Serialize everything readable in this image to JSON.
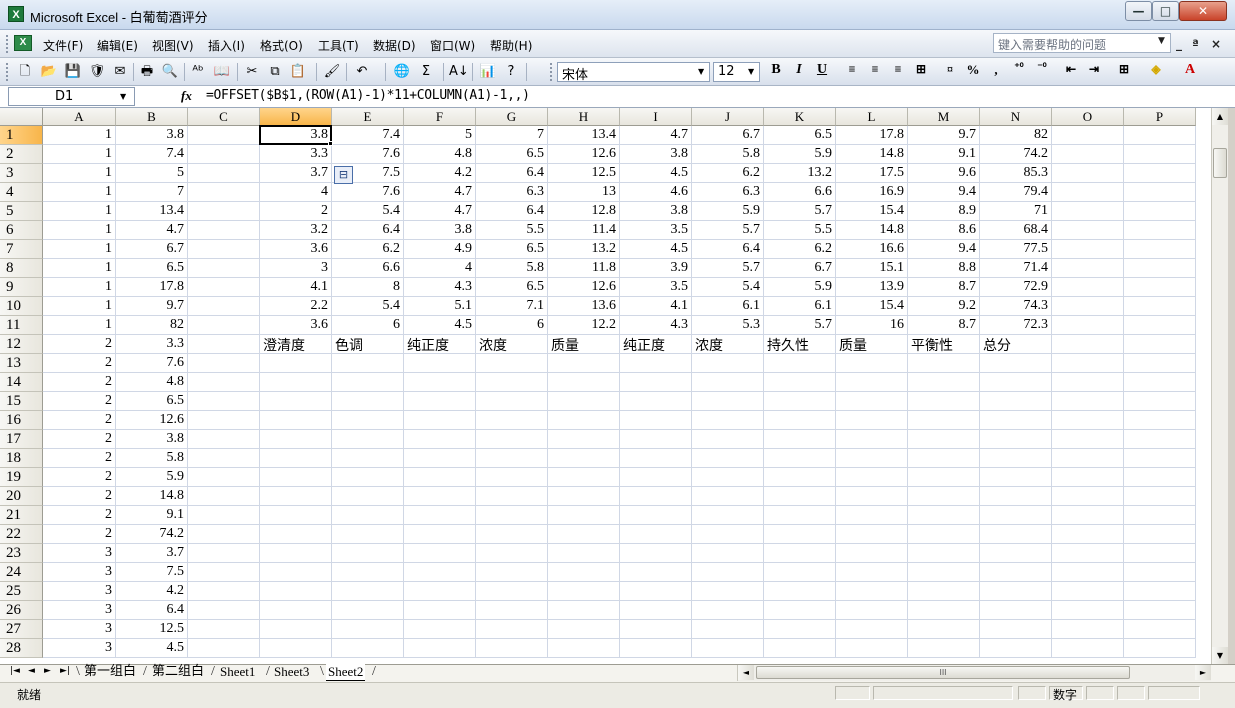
{
  "window": {
    "title": "Microsoft Excel - 白葡萄酒评分",
    "app_icon_text": "X",
    "minimize": "—",
    "maximize": "□",
    "close": "✕"
  },
  "menu": {
    "doc_icon_text": "X",
    "items": [
      "文件(F)",
      "编辑(E)",
      "视图(V)",
      "插入(I)",
      "格式(O)",
      "工具(T)",
      "数据(D)",
      "窗口(W)",
      "帮助(H)"
    ],
    "help_placeholder": "键入需要帮助的问题",
    "doc_minimize": "_",
    "doc_restore": "ª",
    "doc_close": "×"
  },
  "toolbar": {
    "icons": [
      "new-icon",
      "open-icon",
      "save-icon",
      "permission-icon",
      "email-icon",
      "print-icon",
      "print-preview-icon",
      "spelling-icon",
      "research-icon",
      "cut-icon",
      "copy-icon",
      "paste-icon",
      "format-painter-icon",
      "undo-icon",
      "hyperlink-icon",
      "autosum-icon",
      "sort-ascending-icon",
      "chart-wizard-icon",
      "help-icon"
    ],
    "icon_glyphs": [
      "🗋",
      "📂",
      "💾",
      "🛡",
      "✉",
      "🖶",
      "🔍",
      "ᴬᵇ",
      "📖",
      "✂",
      "⧉",
      "📋",
      "🖌",
      "↶",
      "🌐",
      "Σ",
      "A↓",
      "📊",
      "?"
    ],
    "font_name": "宋体",
    "font_size": "12",
    "bold": "B",
    "italic": "I",
    "underline": "U",
    "percent": "%",
    "comma": ","
  },
  "formula_bar": {
    "name_box": "D1",
    "fx": "fx",
    "formula": "=OFFSET($B$1,(ROW(A1)-1)*11+COLUMN(A1)-1,,)"
  },
  "columns": [
    "A",
    "B",
    "C",
    "D",
    "E",
    "F",
    "G",
    "H",
    "I",
    "J",
    "K",
    "L",
    "M",
    "N",
    "O",
    "P"
  ],
  "rows": [
    "1",
    "2",
    "3",
    "4",
    "5",
    "6",
    "7",
    "8",
    "9",
    "10",
    "11",
    "12",
    "13",
    "14",
    "15",
    "16",
    "17",
    "18",
    "19",
    "20",
    "21",
    "22",
    "23",
    "24",
    "25",
    "26",
    "27",
    "28"
  ],
  "cells": {
    "A": [
      "1",
      "1",
      "1",
      "1",
      "1",
      "1",
      "1",
      "1",
      "1",
      "1",
      "1",
      "2",
      "2",
      "2",
      "2",
      "2",
      "2",
      "2",
      "2",
      "2",
      "2",
      "2",
      "3",
      "3",
      "3",
      "3",
      "3",
      "3"
    ],
    "B": [
      "3.8",
      "7.4",
      "5",
      "7",
      "13.4",
      "4.7",
      "6.7",
      "6.5",
      "17.8",
      "9.7",
      "82",
      "3.3",
      "7.6",
      "4.8",
      "6.5",
      "12.6",
      "3.8",
      "5.8",
      "5.9",
      "14.8",
      "9.1",
      "74.2",
      "3.7",
      "7.5",
      "4.2",
      "6.4",
      "12.5",
      "4.5"
    ],
    "D": [
      "3.8",
      "3.3",
      "3.7",
      "4",
      "2",
      "3.2",
      "3.6",
      "3",
      "4.1",
      "2.2",
      "3.6"
    ],
    "E": [
      "7.4",
      "7.6",
      "7.5",
      "7.6",
      "5.4",
      "6.4",
      "6.2",
      "6.6",
      "8",
      "5.4",
      "6"
    ],
    "F": [
      "5",
      "4.8",
      "4.2",
      "4.7",
      "4.7",
      "3.8",
      "4.9",
      "4",
      "4.3",
      "5.1",
      "4.5"
    ],
    "G": [
      "7",
      "6.5",
      "6.4",
      "6.3",
      "6.4",
      "5.5",
      "6.5",
      "5.8",
      "6.5",
      "7.1",
      "6"
    ],
    "H": [
      "13.4",
      "12.6",
      "12.5",
      "13",
      "12.8",
      "11.4",
      "13.2",
      "11.8",
      "12.6",
      "13.6",
      "12.2"
    ],
    "I": [
      "4.7",
      "3.8",
      "4.5",
      "4.6",
      "3.8",
      "3.5",
      "4.5",
      "3.9",
      "3.5",
      "4.1",
      "4.3"
    ],
    "J": [
      "6.7",
      "5.8",
      "6.2",
      "6.3",
      "5.9",
      "5.7",
      "6.4",
      "5.7",
      "5.4",
      "6.1",
      "5.3"
    ],
    "K": [
      "6.5",
      "5.9",
      "13.2",
      "6.6",
      "5.7",
      "5.5",
      "6.2",
      "6.7",
      "5.9",
      "6.1",
      "5.7"
    ],
    "L": [
      "17.8",
      "14.8",
      "17.5",
      "16.9",
      "15.4",
      "14.8",
      "16.6",
      "15.1",
      "13.9",
      "15.4",
      "16"
    ],
    "M": [
      "9.7",
      "9.1",
      "9.6",
      "9.4",
      "8.9",
      "8.6",
      "9.4",
      "8.8",
      "8.7",
      "9.2",
      "8.7"
    ],
    "N": [
      "82",
      "74.2",
      "85.3",
      "79.4",
      "71",
      "68.4",
      "77.5",
      "71.4",
      "72.9",
      "74.3",
      "72.3"
    ]
  },
  "row12_labels": {
    "D": "澄清度",
    "E": "色调",
    "F": "纯正度",
    "G": "浓度",
    "H": "质量",
    "I": "纯正度",
    "J": "浓度",
    "K": "持久性",
    "L": "质量",
    "M": "平衡性",
    "N": "总分"
  },
  "sheet_tabs": [
    "第一组白",
    "第二组白",
    "Sheet1",
    "Sheet3",
    "Sheet2"
  ],
  "active_sheet": "Sheet2",
  "status": {
    "ready": "就绪",
    "mode": "数字"
  },
  "scroll": {
    "up": "▲",
    "down": "▼",
    "left": "◄",
    "right": "►",
    "grip": "III",
    "tab_nav": [
      "|◄",
      "◄",
      "►",
      "►|"
    ]
  }
}
